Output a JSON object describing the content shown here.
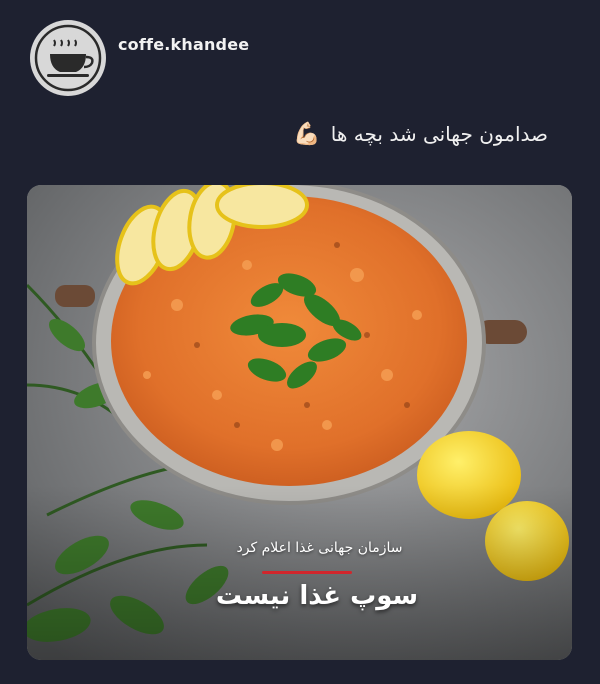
{
  "post": {
    "username": "coffe.khandee",
    "avatar_icon": "coffee-cup-icon",
    "caption": "صدامون جهانی شد بچه ها",
    "caption_emoji": "💪🏻"
  },
  "media": {
    "subtitle": "سازمان جهانی غذا اعلام کرد",
    "title": "سوپ غذا نیست",
    "accent_color": "#d1262c"
  }
}
